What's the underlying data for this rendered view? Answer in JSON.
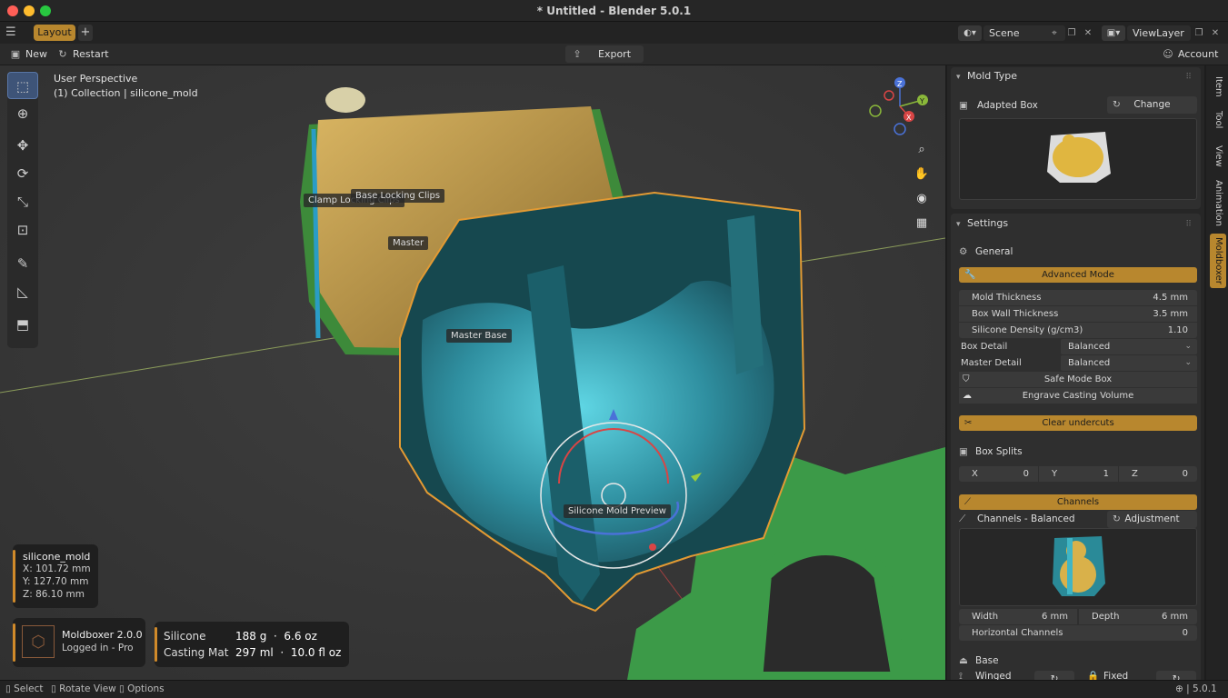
{
  "window": {
    "title": "* Untitled - Blender 5.0.1"
  },
  "workspace": {
    "active_tab": "Layout",
    "add_label": "+"
  },
  "scene": {
    "scene_name": "Scene",
    "view_layer": "ViewLayer"
  },
  "toolbar": {
    "new_label": "New",
    "restart_label": "Restart",
    "export_label": "Export",
    "account_label": "Account"
  },
  "viewport": {
    "perspective": "User Perspective",
    "collection": "(1) Collection | silicone_mold",
    "labels": {
      "clamp": "Clamp Locking Clips",
      "base_clips": "Base Locking Clips",
      "master": "Master",
      "master_base": "Master Base",
      "preview": "Silicone Mold Preview"
    },
    "gizmo_axes": {
      "z": "Z",
      "y": "Y",
      "x": "X"
    }
  },
  "object_info": {
    "name": "silicone_mold",
    "x": "X: 101.72 mm",
    "y": "Y: 127.70 mm",
    "z": "Z: 86.10 mm"
  },
  "addon_info": {
    "title": "Moldboxer 2.0.0",
    "status": "Logged in - Pro"
  },
  "material_info": {
    "silicone_label": "Silicone",
    "silicone_value": "188 g  ·  6.6 oz",
    "casting_label": "Casting Mat",
    "casting_value": "297 ml  ·  10.0 fl oz"
  },
  "side_tabs": [
    "Item",
    "Tool",
    "View",
    "Animation",
    "Moldboxer"
  ],
  "panel": {
    "mold_type": {
      "header": "Mold Type",
      "type_name": "Adapted Box",
      "change_label": "Change"
    },
    "settings": {
      "header": "Settings",
      "general_label": "General",
      "advanced_mode": "Advanced Mode",
      "mold_thickness_label": "Mold Thickness",
      "mold_thickness_value": "4.5 mm",
      "box_wall_label": "Box Wall Thickness",
      "box_wall_value": "3.5 mm",
      "density_label": "Silicone Density (g/cm3)",
      "density_value": "1.10",
      "box_detail_label": "Box Detail",
      "box_detail_value": "Balanced",
      "master_detail_label": "Master Detail",
      "master_detail_value": "Balanced",
      "safe_mode": "Safe Mode Box",
      "engrave": "Engrave Casting Volume",
      "clear_undercuts": "Clear undercuts",
      "box_splits_label": "Box Splits",
      "split_x_label": "X",
      "split_x_value": "0",
      "split_y_label": "Y",
      "split_y_value": "1",
      "split_z_label": "Z",
      "split_z_value": "0",
      "channels_label": "Channels",
      "channels_mode": "Channels - Balanced",
      "adjustment_label": "Adjustment",
      "width_label": "Width",
      "width_value": "6 mm",
      "depth_label": "Depth",
      "depth_value": "6 mm",
      "horizontal_label": "Horizontal Channels",
      "horizontal_value": "0",
      "base_label": "Base",
      "winged_label": "Winged",
      "fixed_label": "Fixed"
    }
  },
  "statusbar": {
    "select": "Select",
    "rotate": "Rotate View",
    "options": "Options",
    "version": "5.0.1"
  }
}
